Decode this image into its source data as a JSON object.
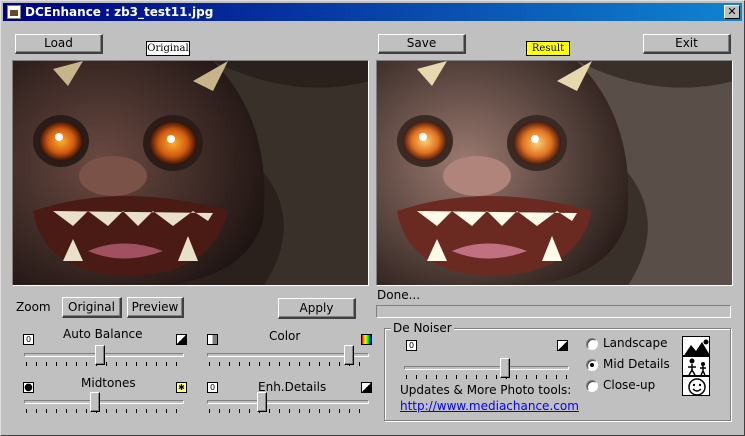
{
  "window": {
    "title": "DCEnhance : zb3_test11.jpg",
    "close_glyph": "✕"
  },
  "buttons": {
    "load": "Load",
    "save": "Save",
    "exit": "Exit",
    "original": "Original",
    "preview": "Preview",
    "apply": "Apply"
  },
  "tags": {
    "original": "Original",
    "result": "Result"
  },
  "zoom_label": "Zoom",
  "status": "Done...",
  "sliders": {
    "auto_balance": {
      "label": "Auto Balance",
      "level": 0.47
    },
    "color": {
      "label": "Color",
      "level": 0.9
    },
    "midtones": {
      "label": "Midtones",
      "level": 0.44
    },
    "enh_details": {
      "label": "Enh.Details",
      "level": 0.33
    },
    "denoiser": {
      "level": 0.62
    }
  },
  "denoiser": {
    "caption": "De Noiser",
    "options": [
      {
        "label": "Landscape",
        "selected": false
      },
      {
        "label": "Mid Details",
        "selected": true
      },
      {
        "label": "Close-up",
        "selected": false
      }
    ],
    "updates_text": "Updates & More Photo tools:",
    "link_text": "http://www.mediachance.com"
  },
  "colors": {
    "title_start": "#000080",
    "title_end": "#1084d0",
    "result_tag": "#ffff00",
    "link": "#0000ff"
  }
}
